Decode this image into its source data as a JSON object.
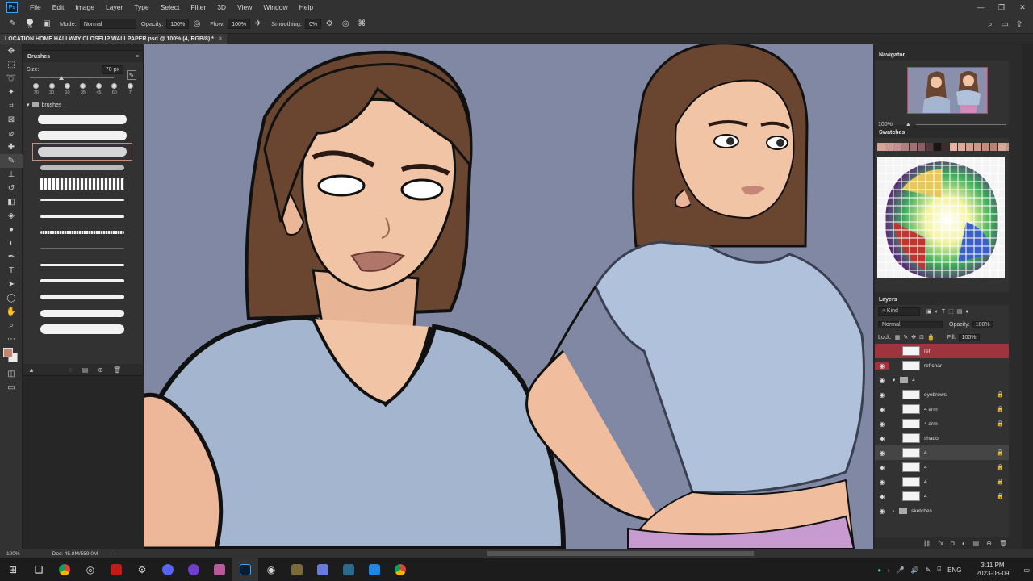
{
  "menu": {
    "app_logo": "Ps",
    "items": [
      "File",
      "Edit",
      "Image",
      "Layer",
      "Type",
      "Select",
      "Filter",
      "3D",
      "View",
      "Window",
      "Help"
    ]
  },
  "options": {
    "brush_size": "70",
    "mode_label": "Mode:",
    "mode_value": "Normal",
    "opacity_label": "Opacity:",
    "opacity_value": "100%",
    "flow_label": "Flow:",
    "flow_value": "100%",
    "smoothing_label": "Smoothing:",
    "smoothing_value": "0%"
  },
  "document": {
    "tab_title": "LOCATION HOME HALLWAY CLOSEUP WALLPAPER.psd @ 100% (4, RGB/8) *",
    "close": "×"
  },
  "brushes": {
    "title": "Brushes",
    "size_label": "Size:",
    "size_value": "70 px",
    "presets": [
      "70",
      "30",
      "10",
      "35",
      "45",
      "60",
      "7"
    ],
    "folder": "brushes"
  },
  "navigator": {
    "title": "Navigator",
    "zoom": "100%"
  },
  "swatches": {
    "title": "Swatches",
    "top_row": [
      "#d9a496",
      "#cf9a92",
      "#c79090",
      "#b47f82",
      "#a46f74",
      "#8e5e64",
      "#503a3d",
      "#1a1414",
      "#3c2d2d",
      "#e8b4a8",
      "#e0aa9c",
      "#d89f90",
      "#cf9787",
      "#c68c7c",
      "#ba8272",
      "#d8a898",
      "#c99384"
    ]
  },
  "layers": {
    "title": "Layers",
    "kind": "Kind",
    "blend": "Normal",
    "opacity_label": "Opacity:",
    "opacity_value": "100%",
    "lock_label": "Lock:",
    "fill_label": "Fill:",
    "fill_value": "100%",
    "rows": [
      {
        "name": "ref",
        "kind": "layer"
      },
      {
        "name": "ref char",
        "kind": "layer"
      },
      {
        "name": "4",
        "kind": "group"
      },
      {
        "name": "eyebrows",
        "kind": "layer"
      },
      {
        "name": "4 arm",
        "kind": "layer"
      },
      {
        "name": "4 arm",
        "kind": "layer"
      },
      {
        "name": "shado",
        "kind": "layer"
      },
      {
        "name": "4",
        "kind": "layer",
        "selected": true
      },
      {
        "name": "4",
        "kind": "layer"
      },
      {
        "name": "4",
        "kind": "layer"
      },
      {
        "name": "4",
        "kind": "layer"
      },
      {
        "name": "sketches",
        "kind": "group"
      }
    ]
  },
  "status": {
    "zoom": "100%",
    "doc": "Doc: 45.8M/559.0M"
  },
  "taskbar": {
    "lang": "ENG",
    "time": "3:11 PM",
    "date": "2023-06-09"
  }
}
